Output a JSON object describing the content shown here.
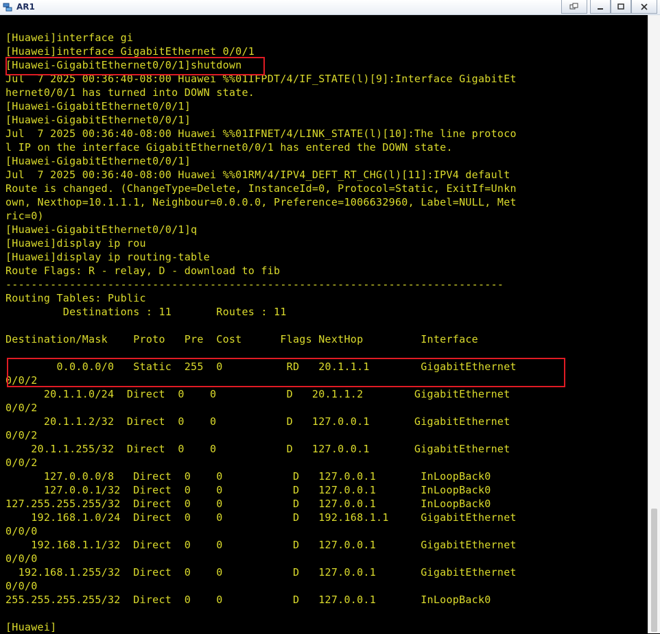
{
  "window": {
    "title": "AR1",
    "controls": {
      "restore_glyph": "⧉",
      "minimize_glyph": "–",
      "maximize_glyph": "□",
      "close_glyph": "✕"
    }
  },
  "colors": {
    "terminal_bg": "#000000",
    "terminal_text": "#dcdc2c",
    "highlight_border": "#e01b24"
  },
  "terminal": {
    "lines": [
      "[Huawei]interface gi",
      "[Huawei]interface GigabitEthernet 0/0/1",
      "[Huawei-GigabitEthernet0/0/1]shutdown",
      "Jul  7 2025 00:36:40-08:00 Huawei %%01IFPDT/4/IF_STATE(l)[9]:Interface GigabitEt",
      "hernet0/0/1 has turned into DOWN state.",
      "[Huawei-GigabitEthernet0/0/1]",
      "[Huawei-GigabitEthernet0/0/1]",
      "Jul  7 2025 00:36:40-08:00 Huawei %%01IFNET/4/LINK_STATE(l)[10]:The line protoco",
      "l IP on the interface GigabitEthernet0/0/1 has entered the DOWN state.",
      "[Huawei-GigabitEthernet0/0/1]",
      "Jul  7 2025 00:36:40-08:00 Huawei %%01RM/4/IPV4_DEFT_RT_CHG(l)[11]:IPV4 default",
      "Route is changed. (ChangeType=Delete, InstanceId=0, Protocol=Static, ExitIf=Unkn",
      "own, Nexthop=10.1.1.1, Neighbour=0.0.0.0, Preference=1006632960, Label=NULL, Met",
      "ric=0)",
      "[Huawei-GigabitEthernet0/0/1]q",
      "[Huawei]display ip rou",
      "[Huawei]display ip routing-table",
      "Route Flags: R - relay, D - download to fib",
      "------------------------------------------------------------------------------",
      "Routing Tables: Public",
      "         Destinations : 11       Routes : 11",
      "",
      "Destination/Mask    Proto   Pre  Cost      Flags NextHop         Interface",
      "",
      "        0.0.0.0/0   Static  255  0          RD   20.1.1.1        GigabitEthernet",
      "0/0/2",
      "      20.1.1.0/24  Direct  0    0           D   20.1.1.2        GigabitEthernet",
      "0/0/2",
      "      20.1.1.2/32  Direct  0    0           D   127.0.0.1       GigabitEthernet",
      "0/0/2",
      "    20.1.1.255/32  Direct  0    0           D   127.0.0.1       GigabitEthernet",
      "0/0/2",
      "      127.0.0.0/8   Direct  0    0           D   127.0.0.1       InLoopBack0",
      "      127.0.0.1/32  Direct  0    0           D   127.0.0.1       InLoopBack0",
      "127.255.255.255/32  Direct  0    0           D   127.0.0.1       InLoopBack0",
      "    192.168.1.0/24  Direct  0    0           D   192.168.1.1     GigabitEthernet",
      "0/0/0",
      "    192.168.1.1/32  Direct  0    0           D   127.0.0.1       GigabitEthernet",
      "0/0/0",
      "  192.168.1.255/32  Direct  0    0           D   127.0.0.1       GigabitEthernet",
      "0/0/0",
      "255.255.255.255/32  Direct  0    0           D   127.0.0.1       InLoopBack0",
      "",
      "[Huawei]"
    ]
  }
}
